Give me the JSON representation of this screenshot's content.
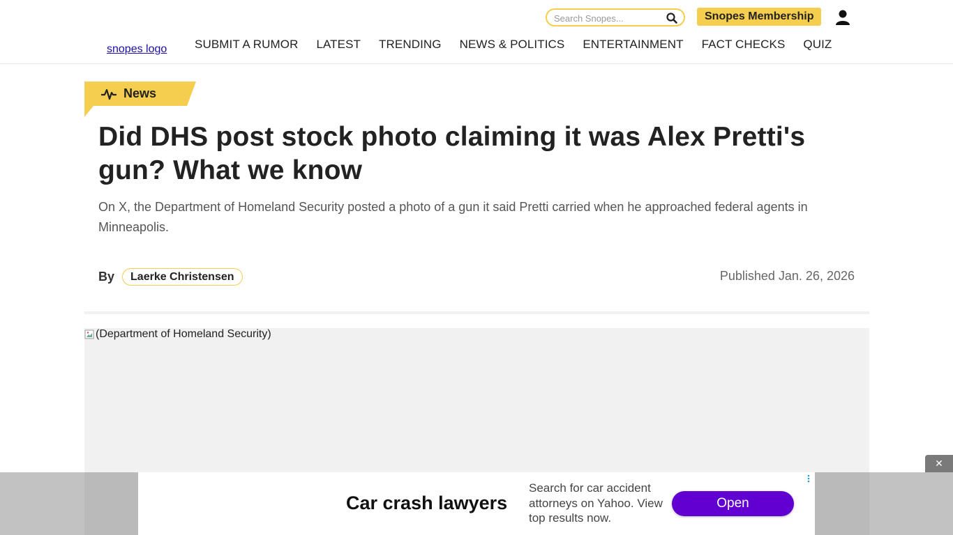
{
  "header": {
    "search": {
      "placeholder": "Search Snopes..."
    },
    "membership_label": "Snopes Membership",
    "logo_alt": "snopes logo",
    "nav": [
      "SUBMIT A RUMOR",
      "LATEST",
      "TRENDING",
      "NEWS & POLITICS",
      "ENTERTAINMENT",
      "FACT CHECKS",
      "QUIZ"
    ]
  },
  "article": {
    "category": "News",
    "title": "Did DHS post stock photo claiming it was Alex Pretti's gun? What we know",
    "subtitle": "On X, the Department of Homeland Security posted a photo of a gun it said Pretti carried when he approached federal agents in Minneapolis.",
    "by_label": "By",
    "author": "Laerke Christensen",
    "published": "Published Jan. 26, 2026",
    "hero_alt": "(Department of Homeland Security)"
  },
  "ad": {
    "close_label": "✕",
    "headline": "Car crash lawyers",
    "body": "Search for car accident attorneys on Yahoo. View top results now.",
    "cta": "Open"
  },
  "colors": {
    "accent": "#f5cd4f",
    "ad_button": "#6001d2",
    "hero_bg": "#f1f1f1"
  },
  "icons": [
    "search-icon",
    "user-icon",
    "pulse-icon",
    "broken-image-icon",
    "ad-info-icon",
    "close-icon"
  ]
}
